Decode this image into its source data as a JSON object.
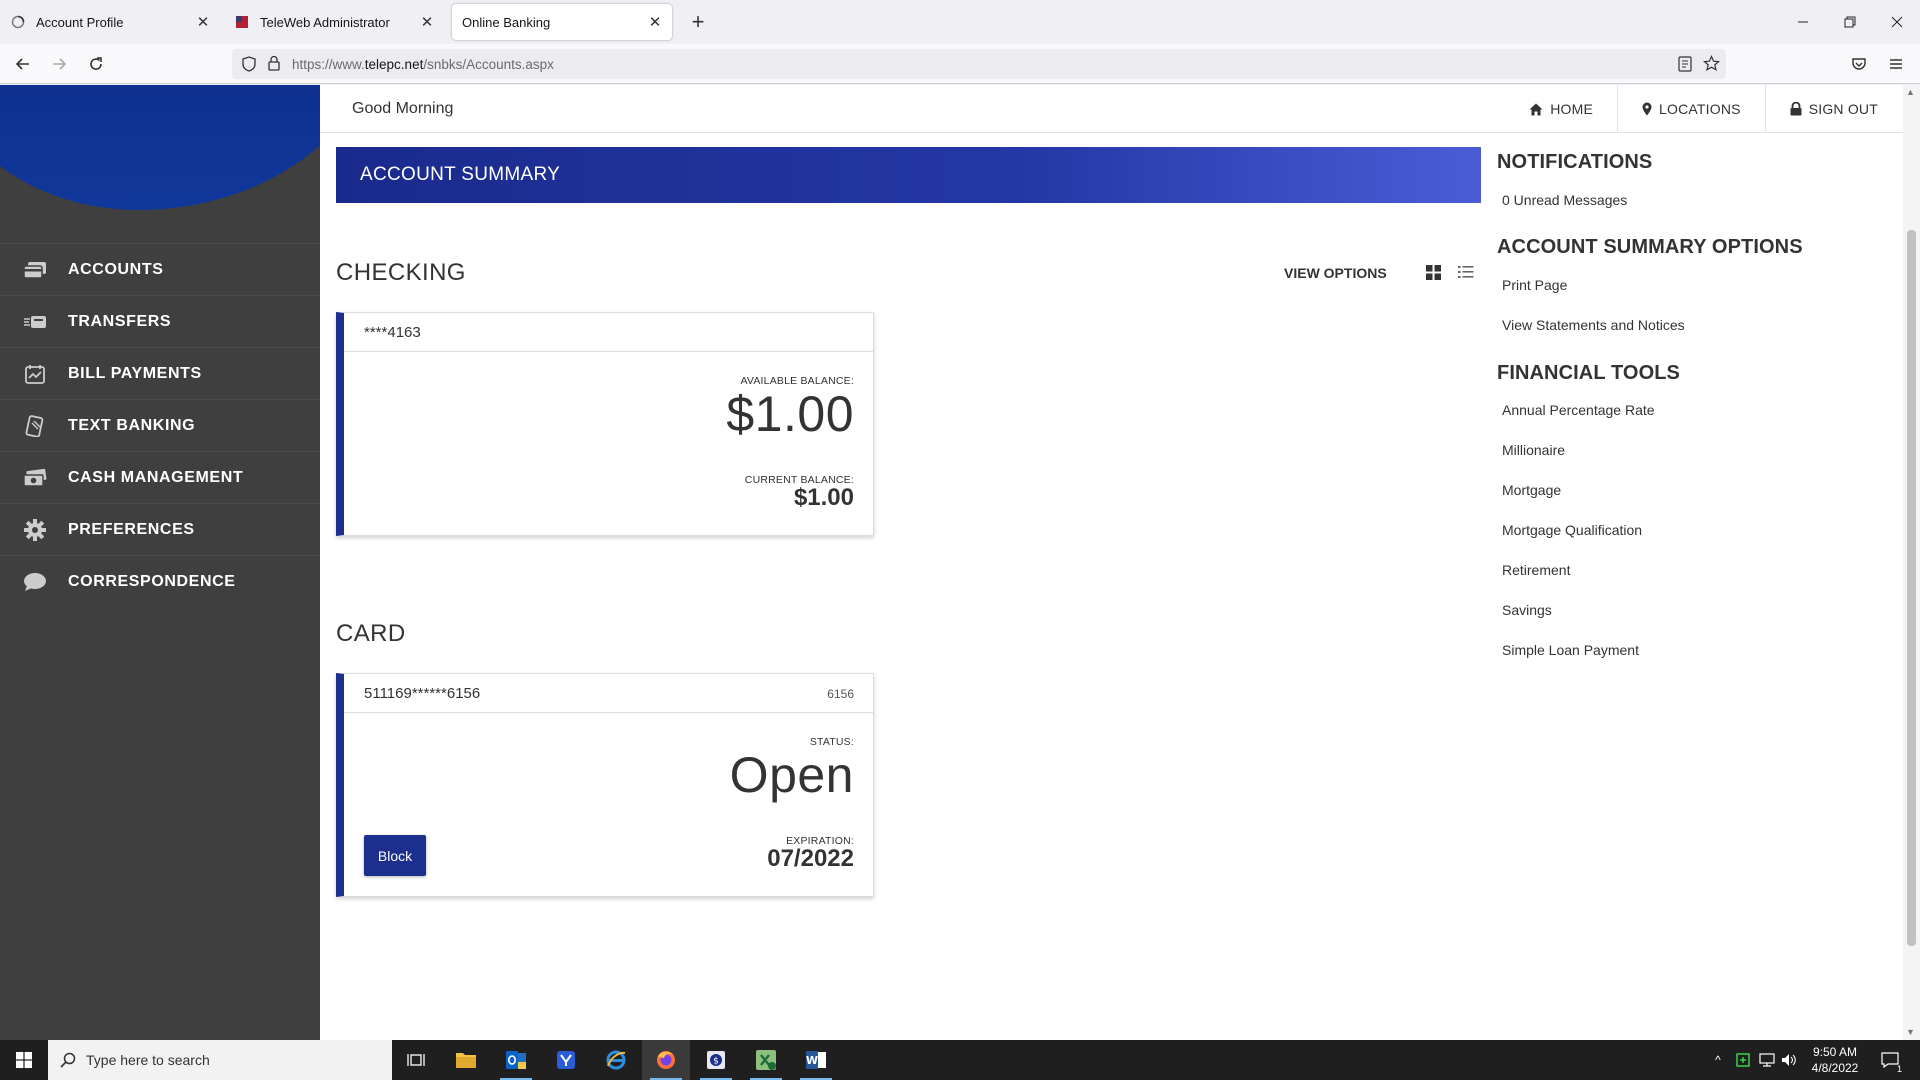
{
  "browser": {
    "tabs": [
      {
        "title": "Account Profile"
      },
      {
        "title": "TeleWeb Administrator"
      },
      {
        "title": "Online Banking"
      }
    ],
    "url_prefix": "https://www.",
    "url_domain": "telepc.net",
    "url_path": "/snbks/Accounts.aspx"
  },
  "header": {
    "greeting": "Good Morning",
    "nav": [
      {
        "label": "HOME",
        "icon": "home-icon"
      },
      {
        "label": "LOCATIONS",
        "icon": "map-pin-icon"
      },
      {
        "label": "SIGN OUT",
        "icon": "lock-icon"
      }
    ]
  },
  "sidebar": {
    "items": [
      {
        "label": "ACCOUNTS",
        "icon": "accounts-icon"
      },
      {
        "label": "TRANSFERS",
        "icon": "transfers-icon"
      },
      {
        "label": "BILL PAYMENTS",
        "icon": "bill-payments-icon"
      },
      {
        "label": "TEXT BANKING",
        "icon": "text-banking-icon"
      },
      {
        "label": "CASH MANAGEMENT",
        "icon": "cash-icon"
      },
      {
        "label": "PREFERENCES",
        "icon": "gear-icon"
      },
      {
        "label": "CORRESPONDENCE",
        "icon": "chat-bubble-icon"
      }
    ]
  },
  "main": {
    "banner_title": "ACCOUNT SUMMARY",
    "view_options_label": "VIEW OPTIONS",
    "checking": {
      "heading": "CHECKING",
      "account_number": "****4163",
      "available_label": "AVAILABLE BALANCE:",
      "available_value": "$1.00",
      "current_label": "CURRENT BALANCE:",
      "current_value": "$1.00"
    },
    "card": {
      "heading": "CARD",
      "card_number": "511169******6156",
      "card_tag": "6156",
      "status_label": "STATUS:",
      "status_value": "Open",
      "expiration_label": "EXPIRATION:",
      "expiration_value": "07/2022",
      "block_label": "Block"
    }
  },
  "right": {
    "notifications_heading": "NOTIFICATIONS",
    "unread": "0 Unread Messages",
    "options_heading": "ACCOUNT SUMMARY OPTIONS",
    "options": [
      "Print Page",
      "View Statements and Notices"
    ],
    "tools_heading": "FINANCIAL TOOLS",
    "tools": [
      "Annual Percentage Rate",
      "Millionaire",
      "Mortgage",
      "Mortgage Qualification",
      "Retirement",
      "Savings",
      "Simple Loan Payment"
    ]
  },
  "taskbar": {
    "search_placeholder": "Type here to search",
    "time": "9:50 AM",
    "date": "4/8/2022",
    "notification_count": "1"
  },
  "colors": {
    "brand_blue": "#1d2f8c",
    "sidebar_bg": "#3f3f3f"
  }
}
